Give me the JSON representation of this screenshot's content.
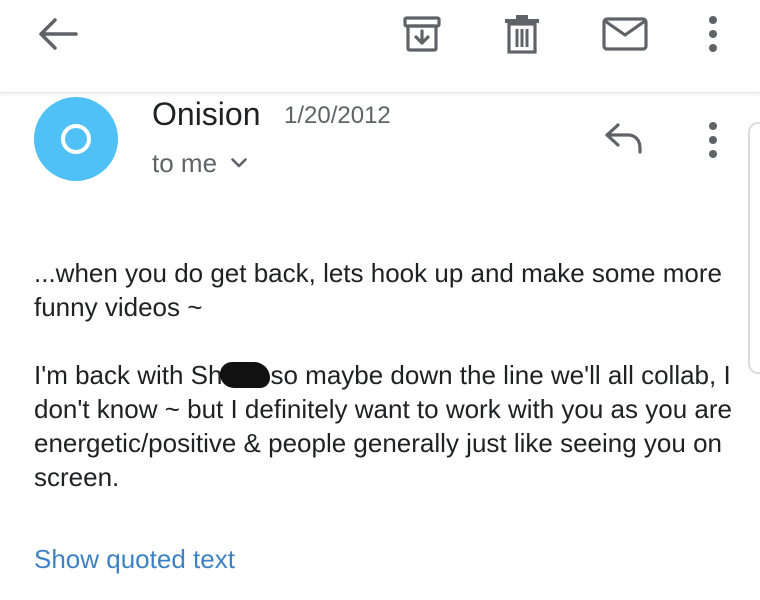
{
  "toolbar": {
    "back_icon": "arrow-back-icon",
    "archive_icon": "archive-icon",
    "delete_icon": "trash-icon",
    "mail_icon": "mail-icon",
    "more_icon": "more-vert-icon"
  },
  "message": {
    "sender": "Onision",
    "date": "1/20/2012",
    "recipient": "to me",
    "avatar_color": "#4fc1f6",
    "reply_icon": "reply-icon",
    "more_icon": "more-vert-icon",
    "body": {
      "p1": "...when you do get back, lets hook up and make some more funny videos ~",
      "p2_before": "I'm back with Sh",
      "p2_after": "so maybe down the line we'll all collab, I don't know ~ but I definitely want to work with you as you are energetic/positive & people generally just like seeing you on screen."
    },
    "show_quoted": "Show quoted text"
  },
  "colors": {
    "link": "#3e82c4",
    "text": "#202124",
    "secondary": "#5f6368"
  }
}
